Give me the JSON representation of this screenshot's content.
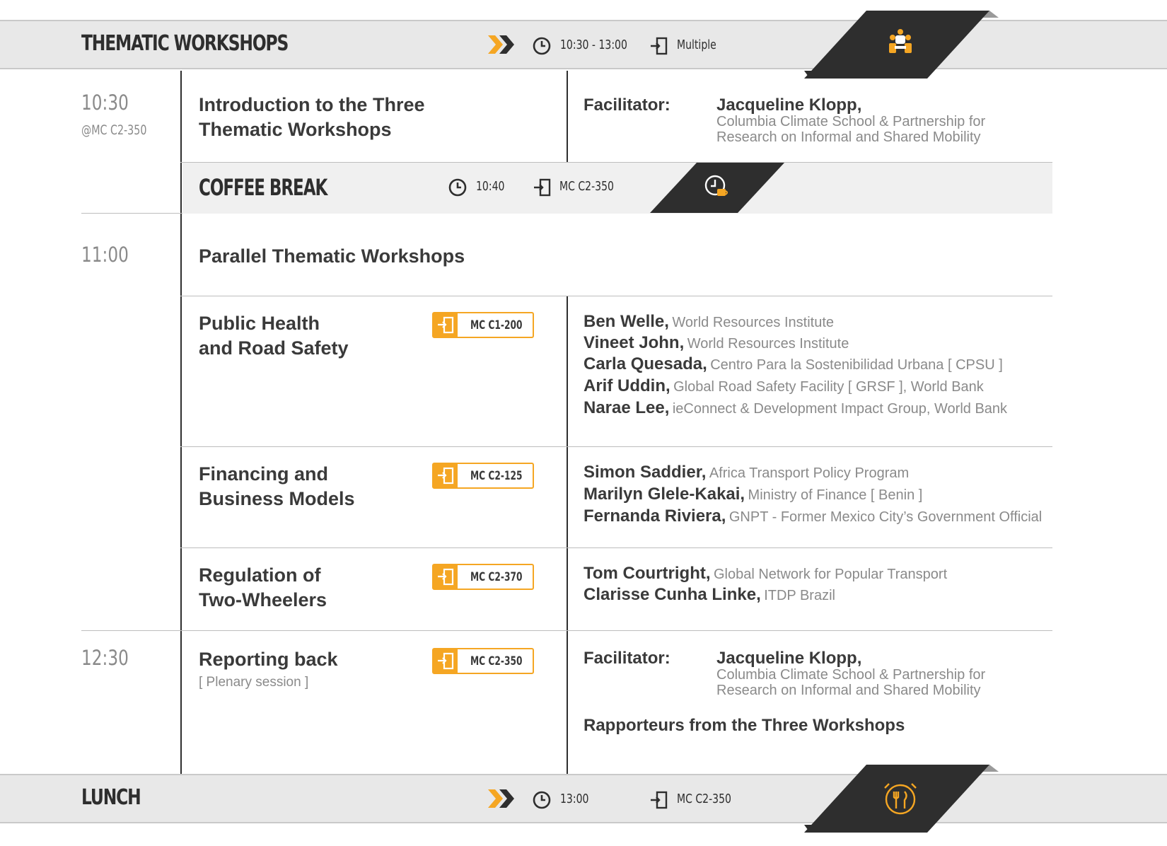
{
  "top_banner": {
    "title": "THEMATIC WORKSHOPS",
    "time": "10:30 - 13:00",
    "location": "Multiple",
    "icon": "people-meeting-icon"
  },
  "slot_1030": {
    "time": "10:30",
    "room": "@MC C2-350",
    "session_line1": "Introduction to the Three",
    "session_line2": "Thematic Workshops",
    "facilitator_label": "Facilitator:",
    "facilitator_name": "Jacqueline Klopp,",
    "facilitator_aff_line1": "Columbia Climate School & Partnership for",
    "facilitator_aff_line2": "Research on Informal and Shared Mobility"
  },
  "coffee_break": {
    "title": "COFFEE BREAK",
    "time": "10:40",
    "room": "MC C2-350",
    "icon": "coffee-clock-icon"
  },
  "slot_1100": {
    "time": "11:00",
    "title": "Parallel Thematic Workshops",
    "workshops": [
      {
        "line1": "Public Health",
        "line2": "and Road Safety",
        "room": "MC C1-200",
        "speakers": [
          {
            "name": "Ben Welle,",
            "aff": "World Resources Institute"
          },
          {
            "name": "Vineet John,",
            "aff": "World Resources Institute"
          },
          {
            "name": "Carla Quesada,",
            "aff": "Centro Para la Sostenibilidad Urbana [ CPSU ]"
          },
          {
            "name": "Arif Uddin,",
            "aff": "Global Road Safety Facility [ GRSF ], World Bank"
          },
          {
            "name": "Narae Lee,",
            "aff": "ieConnect & Development Impact Group, World Bank"
          }
        ]
      },
      {
        "line1": "Financing and",
        "line2": "Business Models",
        "room": "MC C2-125",
        "speakers": [
          {
            "name": "Simon Saddier,",
            "aff": "Africa Transport Policy Program"
          },
          {
            "name": "Marilyn Glele-Kakai,",
            "aff": "Ministry of Finance [ Benin ]"
          },
          {
            "name": "Fernanda Riviera,",
            "aff": "GNPT - Former Mexico City’s Government Official"
          }
        ]
      },
      {
        "line1": "Regulation of",
        "line2": "Two-Wheelers",
        "room": "MC C2-370",
        "speakers": [
          {
            "name": "Tom Courtright,",
            "aff": "Global Network for Popular Transport"
          },
          {
            "name": "Clarisse Cunha Linke,",
            "aff": "ITDP Brazil"
          }
        ]
      }
    ]
  },
  "slot_1230": {
    "time": "12:30",
    "title": "Reporting back",
    "subtitle": "[ Plenary session ]",
    "room": "MC C2-350",
    "facilitator_label": "Facilitator:",
    "facilitator_name": "Jacqueline Klopp,",
    "facilitator_aff_line1": "Columbia Climate School & Partnership for",
    "facilitator_aff_line2": "Research on Informal and Shared Mobility",
    "rapporteurs": "Rapporteurs from the Three Workshops"
  },
  "bottom_banner": {
    "title": "LUNCH",
    "time": "13:00",
    "location": "MC C2-350",
    "icon": "cutlery-alarm-icon"
  },
  "colors": {
    "accent": "#f5a623",
    "dark": "#2e2e2e",
    "muted": "#8a8a8a",
    "banner": "#e8e8e8"
  }
}
